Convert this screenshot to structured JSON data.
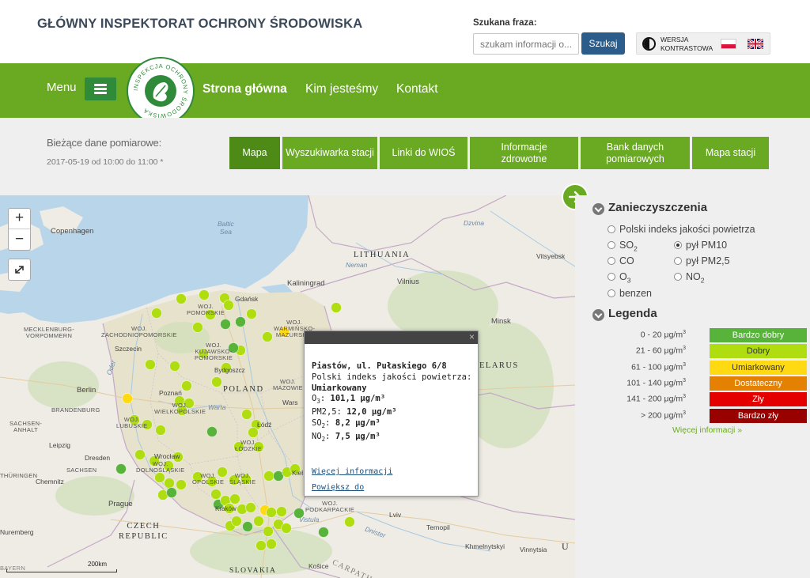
{
  "header": {
    "site_title": "GŁÓWNY INSPEKTORAT OCHRONY ŚRODOWISKA",
    "search_label": "Szukana fraza:",
    "search_placeholder": "szukam informacji o...",
    "search_button": "Szukaj",
    "contrast_label": "WERSJA\nKONTRASTOWA",
    "flags": [
      "pl-flag-icon",
      "uk-flag-icon"
    ]
  },
  "nav": {
    "menu_label": "Menu",
    "logo_text": "INSPEKCJA OCHRONY ŚRODOWISKA",
    "items": [
      "Strona główna",
      "Kim jesteśmy",
      "Kontakt"
    ]
  },
  "subheader": {
    "current_label": "Bieżące dane pomiarowe:",
    "current_date": "2017-05-19 od 10:00 do 11:00 *",
    "tabs": [
      "Mapa",
      "Wyszukiwarka stacji",
      "Linki do WIOŚ",
      "Informacje zdrowotne",
      "Bank danych pomiarowych",
      "Mapa stacji"
    ],
    "active_tab": "Mapa"
  },
  "map": {
    "scale_label": "200km",
    "labels": {
      "copenhagen": "Copenhagen",
      "baltic": "Baltic\nSea",
      "lithuania": "LITHUANIA",
      "kaliningrad": "Kaliningrad",
      "vilnius": "Vilnius",
      "vitsyebsk": "Vitsyebsk",
      "minsk": "Minsk",
      "belarus": "ELARUS",
      "gdansk": "Gdańsk",
      "szczecin": "Szczecin",
      "berlin": "Berlin",
      "poznan": "Poznań",
      "poland": "POLAND",
      "bydgoszcz": "Bydgoszcz",
      "lodz": "Łódź",
      "leipzig": "Leipzig",
      "dresden": "Dresden",
      "wroclaw": "Wrocław",
      "chemnitz": "Chemnitz",
      "prague": "Prague",
      "czech": "CZECH\nREPUBLIC",
      "nuremberg": "Nuremberg",
      "krakow": "Kraków",
      "slovakia": "SLOVAKIA",
      "kosice": "Košice",
      "lviv": "Lviv",
      "ternopil": "Ternopil",
      "khmelnytskyi": "Khmelnytskyi",
      "vinnytsia": "Vinnytsia",
      "u": "U",
      "mecklenburg": "MECKLENBURG-\nVORPOMMERN",
      "brandenburg": "BRANDENBURG",
      "sachsen": "SACHSEN-\nANHALT",
      "sachsen2": "SACHSEN",
      "thuringen": "THÜRINGEN",
      "bayern": "BAYERN",
      "zachodnio": "WOJ.\nZACHODNIOPOMORSKIE",
      "pomorskie": "WOJ.\nPOMORSKIE",
      "warminsko": "WOJ.\nWARMIŃSKO-\nMAZURSKIE",
      "kujawsko": "WOJ.\nKUJAWSKO-\nPOMORSKIE",
      "wielkopolskie": "WOJ.\nWIELKOPOLSKIE",
      "lubuskie": "WOJ.\nLUBUSKIE",
      "lodzkie": "WOJ.\nŁÓDZKIE",
      "dolnoslaskie": "WOJ.\nDOLNOŚLĄSKIE",
      "opolskie": "WOJ.\nOPOLSKIE",
      "slaskie": "WOJ.\nŚLĄSKIE",
      "mazowieckie": "WOJ.\nMAZOWIE",
      "podkarpackie": "WOJ.\nPODKARPACKIE",
      "warszawa": "Wars",
      "kielce": "Kiel",
      "carpathians": "CARPATH",
      "neman": "Neman",
      "dzvina": "Dzvina",
      "dnister": "Dnister",
      "oder": "Oder",
      "warta": "Warta",
      "vistula": "Vistula"
    }
  },
  "popup": {
    "station": "Piastów, ul. Pułaskiego 6/8",
    "index_label": "Polski indeks jakości powietrza:",
    "index_value": "Umiarkowany",
    "rows": [
      {
        "name": "O",
        "sub": "3",
        "value": "101,1 μg/m³"
      },
      {
        "name": "PM2,5",
        "sub": "",
        "value": "12,0 μg/m³"
      },
      {
        "name": "SO",
        "sub": "2",
        "value": "8,2 μg/m³"
      },
      {
        "name": "NO",
        "sub": "2",
        "value": "7,5 μg/m³"
      }
    ],
    "more_link": "Więcej informacji",
    "zoom_link": "Powiększ do"
  },
  "sidebar": {
    "pollution_title": "Zanieczyszczenia",
    "index_option": "Polski indeks jakości powietrza",
    "options": [
      {
        "label": "SO",
        "sub": "2",
        "selected": false
      },
      {
        "label": "pył PM10",
        "sub": "",
        "selected": true
      },
      {
        "label": "CO",
        "sub": "",
        "selected": false
      },
      {
        "label": "pył PM2,5",
        "sub": "",
        "selected": false
      },
      {
        "label": "O",
        "sub": "3",
        "selected": false
      },
      {
        "label": "NO",
        "sub": "2",
        "selected": false
      },
      {
        "label": "benzen",
        "sub": "",
        "selected": false
      }
    ],
    "legend_title": "Legenda",
    "legend": [
      {
        "range": "0 - 20 μg/m",
        "label": "Bardzo dobry",
        "color": "#57b33a",
        "text": "#fff"
      },
      {
        "range": "21 - 60 μg/m",
        "label": "Dobry",
        "color": "#b0dd10",
        "text": "#333"
      },
      {
        "range": "61 - 100 μg/m",
        "label": "Umiarkowany",
        "color": "#ffd911",
        "text": "#333"
      },
      {
        "range": "101 - 140 μg/m",
        "label": "Dostateczny",
        "color": "#e58100",
        "text": "#fff"
      },
      {
        "range": "141 - 200 μg/m",
        "label": "Zły",
        "color": "#e50000",
        "text": "#fff"
      },
      {
        "range": "> 200 μg/m",
        "label": "Bardzo zły",
        "color": "#990000",
        "text": "#fff"
      }
    ],
    "legend_unit_sup": "3",
    "more_info": "Więcej informacji »"
  },
  "colors": {
    "brand_green": "#6aaa22",
    "dark_green": "#2f8a3a",
    "search_blue": "#2c5d8a"
  }
}
